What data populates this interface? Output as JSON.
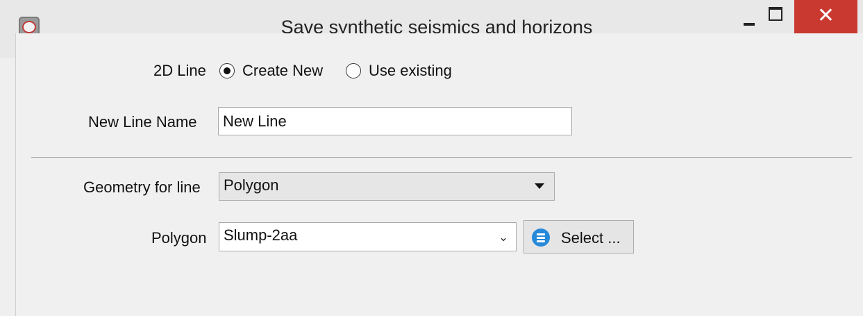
{
  "window": {
    "title": "Save synthetic seismics and horizons",
    "app_icon": "application-icon",
    "controls": {
      "minimize": "minimize-icon",
      "maximize": "maximize-icon",
      "close": "close-icon",
      "close_glyph": "✕",
      "close_color": "#c9392f"
    }
  },
  "form": {
    "line_mode": {
      "label": "2D Line",
      "options": [
        {
          "label": "Create New",
          "selected": true
        },
        {
          "label": "Use existing",
          "selected": false
        }
      ]
    },
    "new_line_name": {
      "label": "New Line Name",
      "value": "New Line"
    },
    "geometry": {
      "label": "Geometry for line",
      "value": "Polygon"
    },
    "polygon": {
      "label": "Polygon",
      "value": "Slump-2aa",
      "select_button": "Select ...",
      "select_icon": "list-icon",
      "select_icon_color": "#2789d9"
    }
  }
}
